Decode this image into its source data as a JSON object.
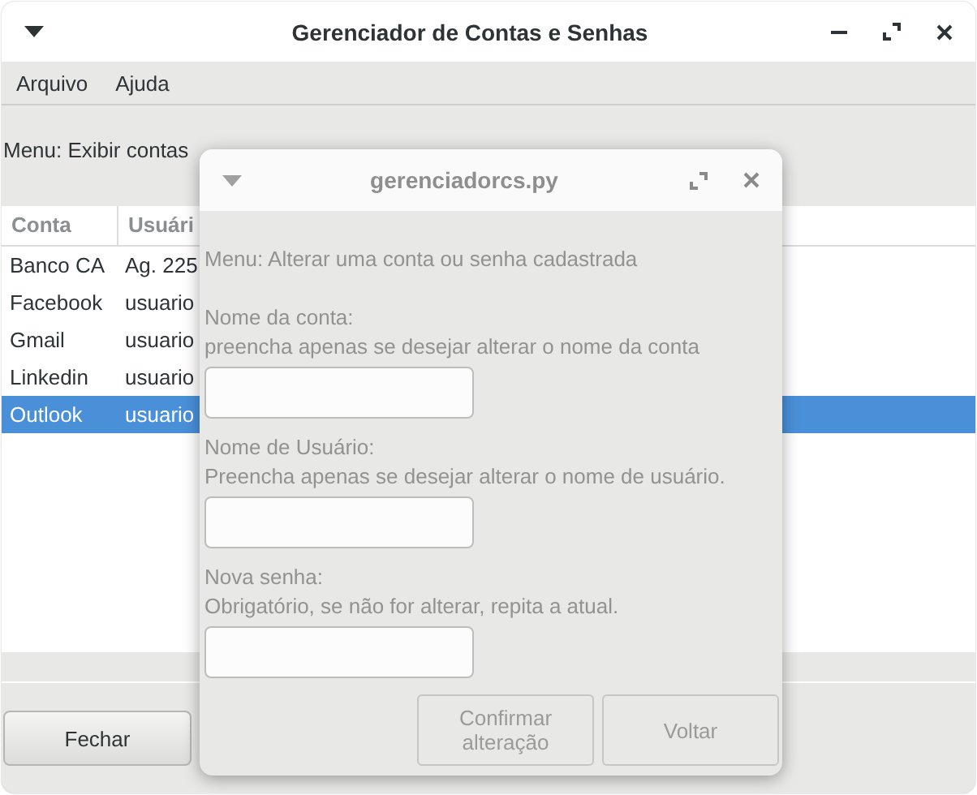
{
  "window": {
    "title": "Gerenciador de Contas e Senhas"
  },
  "menu": [
    "Arquivo",
    "Ajuda"
  ],
  "info": "Menu: Exibir contas",
  "table": {
    "columns": [
      "Conta",
      "Usuári"
    ],
    "rows": [
      {
        "cells": [
          "Banco CA",
          "Ag. 225"
        ],
        "selected": false
      },
      {
        "cells": [
          "Facebook",
          "usuario"
        ],
        "selected": false
      },
      {
        "cells": [
          "Gmail",
          "usuario"
        ],
        "selected": false
      },
      {
        "cells": [
          "Linkedin",
          "usuario"
        ],
        "selected": false
      },
      {
        "cells": [
          "Outlook",
          "usuario"
        ],
        "selected": true
      }
    ]
  },
  "buttons": [
    "Fechar"
  ],
  "dialog": {
    "title": "gerenciadorcs.py",
    "heading": "Menu: Alterar uma conta ou senha cadastrada",
    "fields": [
      {
        "label": "Nome da conta:",
        "hint": "preencha apenas se desejar alterar o nome da conta"
      },
      {
        "label": "Nome de Usuário:",
        "hint": "Preencha apenas se desejar alterar o nome de usuário."
      },
      {
        "label": "Nova senha:",
        "hint": "Obrigatório, se não for alterar, repita a atual."
      }
    ],
    "buttons": [
      "Confirmar alteração",
      "Voltar"
    ]
  }
}
